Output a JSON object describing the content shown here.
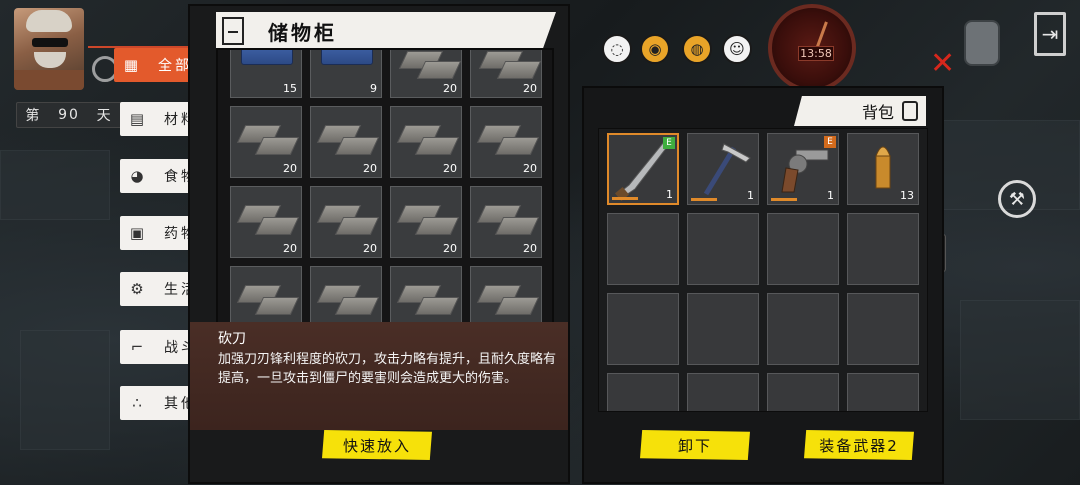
{
  "player": {
    "day_prefix": "第",
    "day_number": "90",
    "day_suffix": "天"
  },
  "categories": [
    {
      "label": "全部",
      "icon": "grid-icon",
      "active": true
    },
    {
      "label": "材料",
      "icon": "planks-icon",
      "active": false
    },
    {
      "label": "食物",
      "icon": "food-icon",
      "active": false
    },
    {
      "label": "药物",
      "icon": "medicine-icon",
      "active": false
    },
    {
      "label": "生活",
      "icon": "life-icon",
      "active": false
    },
    {
      "label": "战斗",
      "icon": "pistol-icon",
      "active": false
    },
    {
      "label": "其他",
      "icon": "dots-icon",
      "active": false
    }
  ],
  "storage": {
    "title": "储物柜",
    "slots": [
      {
        "item": "crate",
        "count": "15"
      },
      {
        "item": "crate",
        "count": "9"
      },
      {
        "item": "planks",
        "count": "20"
      },
      {
        "item": "planks",
        "count": "20"
      },
      {
        "item": "planks",
        "count": "20"
      },
      {
        "item": "planks",
        "count": "20"
      },
      {
        "item": "planks",
        "count": "20"
      },
      {
        "item": "planks",
        "count": "20"
      },
      {
        "item": "planks",
        "count": "20"
      },
      {
        "item": "planks",
        "count": "20"
      },
      {
        "item": "planks",
        "count": "20"
      },
      {
        "item": "planks",
        "count": "20"
      },
      {
        "item": "planks",
        "count": ""
      },
      {
        "item": "planks",
        "count": ""
      },
      {
        "item": "planks",
        "count": ""
      },
      {
        "item": "planks",
        "count": ""
      }
    ],
    "description": {
      "name": "砍刀",
      "text": "加强刀刃锋利程度的砍刀，攻击力略有提升，且耐久度略有提高，一旦攻击到僵尸的要害则会造成更大的伤害。"
    },
    "quick_put_label": "快速放入"
  },
  "status_icons": [
    "pill-icon",
    "eye-icon",
    "cup-icon",
    "smile-icon"
  ],
  "clock": {
    "time": "13:58"
  },
  "backpack": {
    "title": "背包",
    "items": [
      {
        "name": "machete",
        "count": "1",
        "badge": "E",
        "badge_color": "green",
        "selected": true
      },
      {
        "name": "pickaxe",
        "count": "1",
        "badge": "",
        "badge_color": "",
        "selected": false
      },
      {
        "name": "revolver",
        "count": "1",
        "badge": "E",
        "badge_color": "orange",
        "selected": false
      },
      {
        "name": "bullet",
        "count": "13",
        "badge": "",
        "badge_color": "",
        "selected": false
      }
    ],
    "unequip_label": "卸下",
    "equip_weapon_label": "装备武器2"
  },
  "colors": {
    "accent": "#e35a2c",
    "button_yellow": "#f6e10a",
    "selection": "#e08a2a"
  }
}
